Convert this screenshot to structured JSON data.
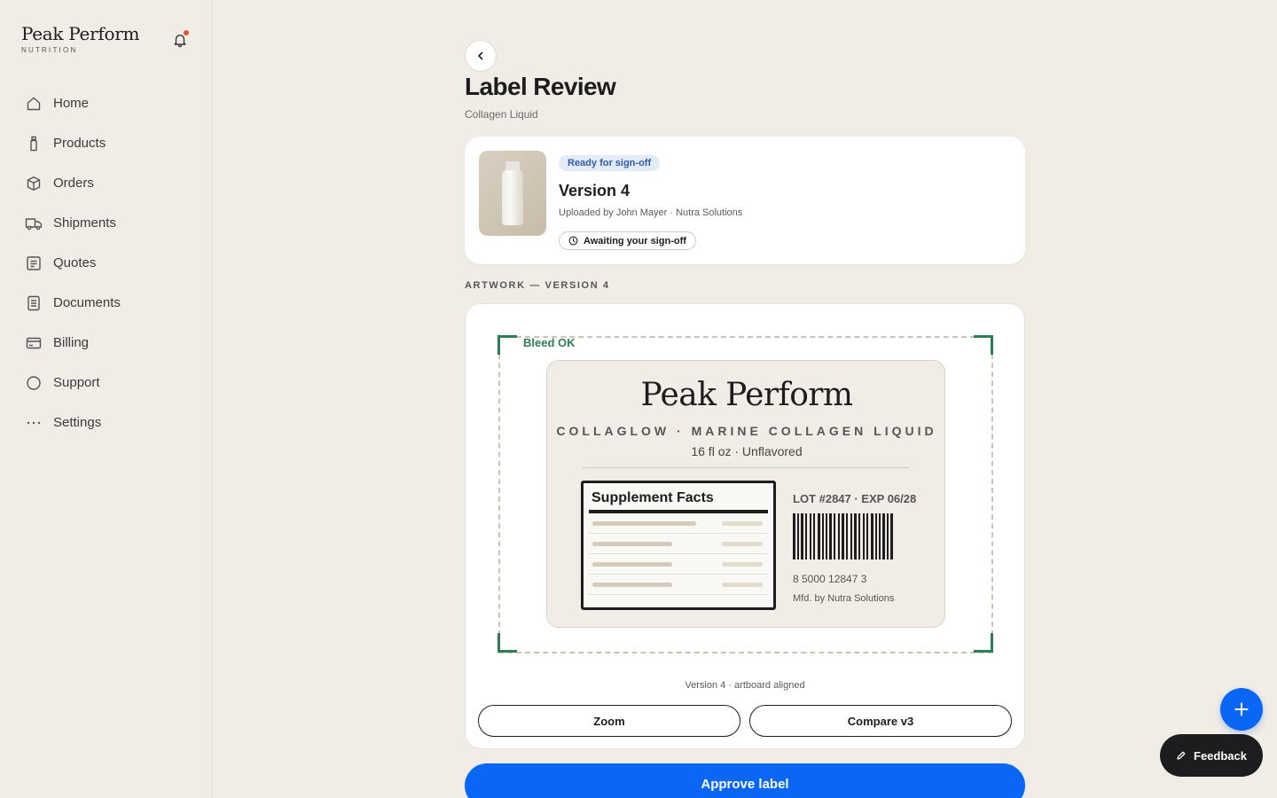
{
  "brand": {
    "name": "Peak Perform",
    "subtitle": "NUTRITION"
  },
  "sidebar": {
    "items": [
      {
        "label": "Home",
        "icon": "home-icon"
      },
      {
        "label": "Products",
        "icon": "bottle-icon"
      },
      {
        "label": "Orders",
        "icon": "box-icon"
      },
      {
        "label": "Shipments",
        "icon": "truck-icon"
      },
      {
        "label": "Quotes",
        "icon": "quote-icon"
      },
      {
        "label": "Documents",
        "icon": "document-icon"
      },
      {
        "label": "Billing",
        "icon": "card-icon"
      },
      {
        "label": "Support",
        "icon": "support-icon"
      },
      {
        "label": "Settings",
        "icon": "more-icon"
      }
    ]
  },
  "page": {
    "title": "Label Review",
    "subtitle": "Collagen Liquid"
  },
  "summary": {
    "status_badge": "Ready for sign-off",
    "version": "Version 4",
    "uploaded": "Uploaded by John Mayer · Nutra Solutions",
    "awaiting": "Awaiting your sign-off"
  },
  "artwork": {
    "section_label": "ARTWORK — VERSION 4",
    "bleed_status": "Bleed OK",
    "label": {
      "brand": "Peak Perform",
      "product": "COLLAGLOW · MARINE COLLAGEN LIQUID",
      "size": "16 fl oz · Unflavored",
      "facts_title": "Supplement Facts",
      "lot": "LOT #2847 · EXP 06/28",
      "barcode_number": "8 5000 12847 3",
      "manufacturer": "Mfd. by Nutra Solutions"
    },
    "caption": "Version 4 · artboard aligned",
    "zoom_label": "Zoom",
    "compare_label": "Compare v3"
  },
  "actions": {
    "approve_label": "Approve label",
    "feedback_label": "Feedback"
  },
  "colors": {
    "accent": "#0a66f5",
    "bleed_ok": "#2f7d55",
    "background": "#f1ede6",
    "notification_dot": "#e5522e"
  }
}
